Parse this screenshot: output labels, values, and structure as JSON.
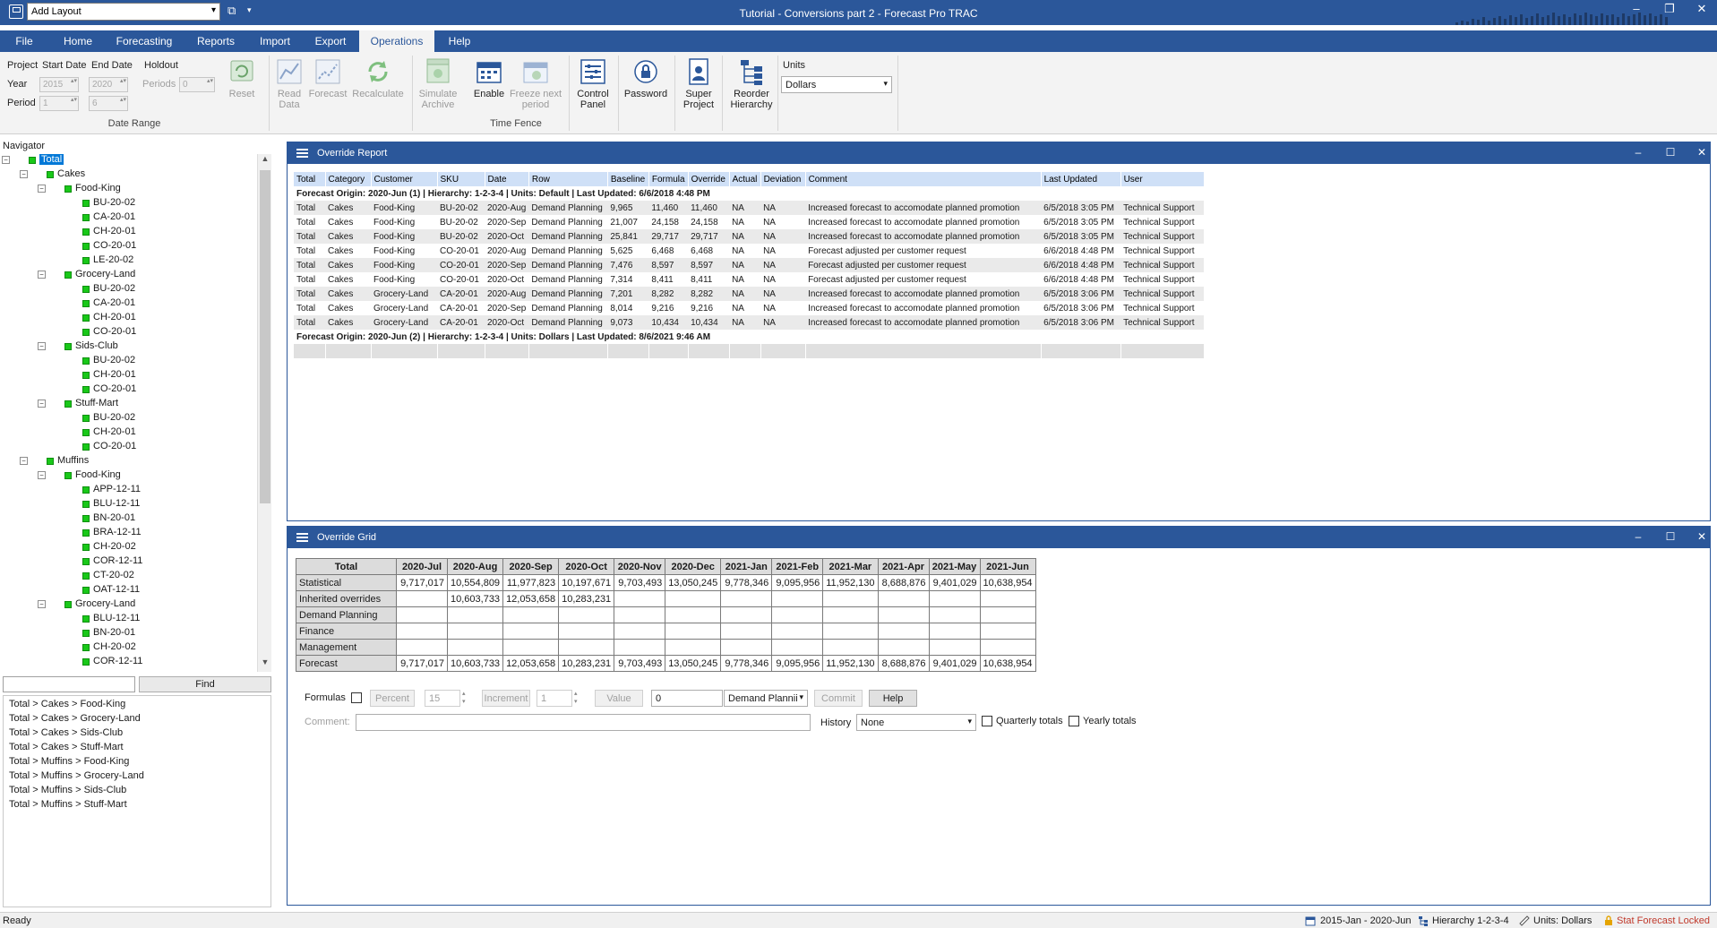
{
  "titlebar": {
    "layout_combo": "Add Layout",
    "window_title": "Tutorial - Conversions part 2 - Forecast Pro TRAC"
  },
  "ribbon_tabs": [
    "File",
    "Home",
    "Forecasting",
    "Reports",
    "Import",
    "Export",
    "Operations",
    "Help"
  ],
  "active_tab": "Operations",
  "ribbon": {
    "date_range": {
      "project_label": "Project",
      "start_date_label": "Start Date",
      "end_date_label": "End Date",
      "holdout_label": "Holdout",
      "year_label": "Year",
      "period_label": "Period",
      "periods_label": "Periods",
      "start_year": "2015",
      "end_year": "2020",
      "start_period": "1",
      "end_period": "6",
      "holdout_periods": "0",
      "reset_label": "Reset",
      "group_label": "Date Range"
    },
    "buttons": {
      "read_data": "Read Data",
      "forecast": "Forecast",
      "recalculate": "Recalculate",
      "simulate_archive": "Simulate Archive",
      "enable": "Enable",
      "freeze_next_period": "Freeze next period",
      "control_panel": "Control Panel",
      "password": "Password",
      "super_project": "Super Project",
      "reorder_hierarchy": "Reorder Hierarchy"
    },
    "time_fence_label": "Time Fence",
    "units_label": "Units",
    "units_value": "Dollars"
  },
  "navigator": {
    "title": "Navigator",
    "tree": [
      {
        "label": "Total",
        "level": 0,
        "expander": true,
        "selected": true
      },
      {
        "label": "Cakes",
        "level": 1,
        "expander": true
      },
      {
        "label": "Food-King",
        "level": 2,
        "expander": true
      },
      {
        "label": "BU-20-02",
        "level": 3
      },
      {
        "label": "CA-20-01",
        "level": 3
      },
      {
        "label": "CH-20-01",
        "level": 3
      },
      {
        "label": "CO-20-01",
        "level": 3
      },
      {
        "label": "LE-20-02",
        "level": 3
      },
      {
        "label": "Grocery-Land",
        "level": 2,
        "expander": true
      },
      {
        "label": "BU-20-02",
        "level": 3
      },
      {
        "label": "CA-20-01",
        "level": 3
      },
      {
        "label": "CH-20-01",
        "level": 3
      },
      {
        "label": "CO-20-01",
        "level": 3
      },
      {
        "label": "Sids-Club",
        "level": 2,
        "expander": true
      },
      {
        "label": "BU-20-02",
        "level": 3
      },
      {
        "label": "CH-20-01",
        "level": 3
      },
      {
        "label": "CO-20-01",
        "level": 3
      },
      {
        "label": "Stuff-Mart",
        "level": 2,
        "expander": true
      },
      {
        "label": "BU-20-02",
        "level": 3
      },
      {
        "label": "CH-20-01",
        "level": 3
      },
      {
        "label": "CO-20-01",
        "level": 3
      },
      {
        "label": "Muffins",
        "level": 1,
        "expander": true
      },
      {
        "label": "Food-King",
        "level": 2,
        "expander": true
      },
      {
        "label": "APP-12-11",
        "level": 3
      },
      {
        "label": "BLU-12-11",
        "level": 3
      },
      {
        "label": "BN-20-01",
        "level": 3
      },
      {
        "label": "BRA-12-11",
        "level": 3
      },
      {
        "label": "CH-20-02",
        "level": 3
      },
      {
        "label": "COR-12-11",
        "level": 3
      },
      {
        "label": "CT-20-02",
        "level": 3
      },
      {
        "label": "OAT-12-11",
        "level": 3
      },
      {
        "label": "Grocery-Land",
        "level": 2,
        "expander": true
      },
      {
        "label": "BLU-12-11",
        "level": 3
      },
      {
        "label": "BN-20-01",
        "level": 3
      },
      {
        "label": "CH-20-02",
        "level": 3
      },
      {
        "label": "COR-12-11",
        "level": 3
      }
    ],
    "find_label": "Find",
    "paths": [
      "Total > Cakes > Food-King",
      "Total > Cakes > Grocery-Land",
      "Total > Cakes > Sids-Club",
      "Total > Cakes > Stuff-Mart",
      "Total > Muffins > Food-King",
      "Total > Muffins > Grocery-Land",
      "Total > Muffins > Sids-Club",
      "Total > Muffins > Stuff-Mart"
    ]
  },
  "override_report": {
    "title": "Override Report",
    "columns": [
      "Total",
      "Category",
      "Customer",
      "SKU",
      "Date",
      "Row",
      "Baseline",
      "Formula",
      "Override",
      "Actual",
      "Deviation",
      "Comment",
      "Last Updated",
      "User"
    ],
    "origin_1": "Forecast Origin: 2020-Jun (1) | Hierarchy: 1-2-3-4 | Units: Default | Last Updated: 6/6/2018 4:48 PM",
    "rows": [
      [
        "Total",
        "Cakes",
        "Food-King",
        "BU-20-02",
        "2020-Aug",
        "Demand Planning",
        "9,965",
        "11,460",
        "11,460",
        "NA",
        "NA",
        "Increased forecast to accomodate planned promotion",
        "6/5/2018 3:05 PM",
        "Technical Support"
      ],
      [
        "Total",
        "Cakes",
        "Food-King",
        "BU-20-02",
        "2020-Sep",
        "Demand Planning",
        "21,007",
        "24,158",
        "24,158",
        "NA",
        "NA",
        "Increased forecast to accomodate planned promotion",
        "6/5/2018 3:05 PM",
        "Technical Support"
      ],
      [
        "Total",
        "Cakes",
        "Food-King",
        "BU-20-02",
        "2020-Oct",
        "Demand Planning",
        "25,841",
        "29,717",
        "29,717",
        "NA",
        "NA",
        "Increased forecast to accomodate planned promotion",
        "6/5/2018 3:05 PM",
        "Technical Support"
      ],
      [
        "Total",
        "Cakes",
        "Food-King",
        "CO-20-01",
        "2020-Aug",
        "Demand Planning",
        "5,625",
        "6,468",
        "6,468",
        "NA",
        "NA",
        "Forecast adjusted per customer request",
        "6/6/2018 4:48 PM",
        "Technical Support"
      ],
      [
        "Total",
        "Cakes",
        "Food-King",
        "CO-20-01",
        "2020-Sep",
        "Demand Planning",
        "7,476",
        "8,597",
        "8,597",
        "NA",
        "NA",
        "Forecast adjusted per customer request",
        "6/6/2018 4:48 PM",
        "Technical Support"
      ],
      [
        "Total",
        "Cakes",
        "Food-King",
        "CO-20-01",
        "2020-Oct",
        "Demand Planning",
        "7,314",
        "8,411",
        "8,411",
        "NA",
        "NA",
        "Forecast adjusted per customer request",
        "6/6/2018 4:48 PM",
        "Technical Support"
      ],
      [
        "Total",
        "Cakes",
        "Grocery-Land",
        "CA-20-01",
        "2020-Aug",
        "Demand Planning",
        "7,201",
        "8,282",
        "8,282",
        "NA",
        "NA",
        "Increased forecast to accomodate planned promotion",
        "6/5/2018 3:06 PM",
        "Technical Support"
      ],
      [
        "Total",
        "Cakes",
        "Grocery-Land",
        "CA-20-01",
        "2020-Sep",
        "Demand Planning",
        "8,014",
        "9,216",
        "9,216",
        "NA",
        "NA",
        "Increased forecast to accomodate planned promotion",
        "6/5/2018 3:06 PM",
        "Technical Support"
      ],
      [
        "Total",
        "Cakes",
        "Grocery-Land",
        "CA-20-01",
        "2020-Oct",
        "Demand Planning",
        "9,073",
        "10,434",
        "10,434",
        "NA",
        "NA",
        "Increased forecast to accomodate planned promotion",
        "6/5/2018 3:06 PM",
        "Technical Support"
      ]
    ],
    "origin_2": "Forecast Origin: 2020-Jun (2) | Hierarchy: 1-2-3-4 | Units: Dollars | Last Updated: 8/6/2021 9:46 AM"
  },
  "override_grid": {
    "title": "Override Grid",
    "corner": "Total",
    "columns": [
      "2020-Jul",
      "2020-Aug",
      "2020-Sep",
      "2020-Oct",
      "2020-Nov",
      "2020-Dec",
      "2021-Jan",
      "2021-Feb",
      "2021-Mar",
      "2021-Apr",
      "2021-May",
      "2021-Jun"
    ],
    "rows": [
      {
        "label": "Statistical",
        "values": [
          "9,717,017",
          "10,554,809",
          "11,977,823",
          "10,197,671",
          "9,703,493",
          "13,050,245",
          "9,778,346",
          "9,095,956",
          "11,952,130",
          "8,688,876",
          "9,401,029",
          "10,638,954"
        ]
      },
      {
        "label": "Inherited overrides",
        "values": [
          "",
          "10,603,733",
          "12,053,658",
          "10,283,231",
          "",
          "",
          "",
          "",
          "",
          "",
          "",
          ""
        ]
      },
      {
        "label": "Demand Planning",
        "values": [
          "",
          "",
          "",
          "",
          "",
          "",
          "",
          "",
          "",
          "",
          "",
          ""
        ]
      },
      {
        "label": "Finance",
        "values": [
          "",
          "",
          "",
          "",
          "",
          "",
          "",
          "",
          "",
          "",
          "",
          ""
        ]
      },
      {
        "label": "Management",
        "values": [
          "",
          "",
          "",
          "",
          "",
          "",
          "",
          "",
          "",
          "",
          "",
          ""
        ]
      },
      {
        "label": "Forecast",
        "values": [
          "9,717,017",
          "10,603,733",
          "12,053,658",
          "10,283,231",
          "9,703,493",
          "13,050,245",
          "9,778,346",
          "9,095,956",
          "11,952,130",
          "8,688,876",
          "9,401,029",
          "10,638,954"
        ]
      }
    ],
    "controls": {
      "formulas_label": "Formulas",
      "percent_label": "Percent",
      "percent_value": "15",
      "increment_label": "Increment",
      "increment_value": "1",
      "value_label": "Value",
      "value_input": "0",
      "row_select": "Demand Plannii",
      "commit_label": "Commit",
      "help_label": "Help",
      "comment_label": "Comment:",
      "history_label": "History",
      "history_value": "None",
      "quarterly_totals": "Quarterly totals",
      "yearly_totals": "Yearly totals"
    }
  },
  "statusbar": {
    "ready": "Ready",
    "date_range": "2015-Jan - 2020-Jun",
    "hierarchy": "Hierarchy 1-2-3-4",
    "units": "Units: Dollars",
    "lock": "Stat Forecast Locked"
  }
}
